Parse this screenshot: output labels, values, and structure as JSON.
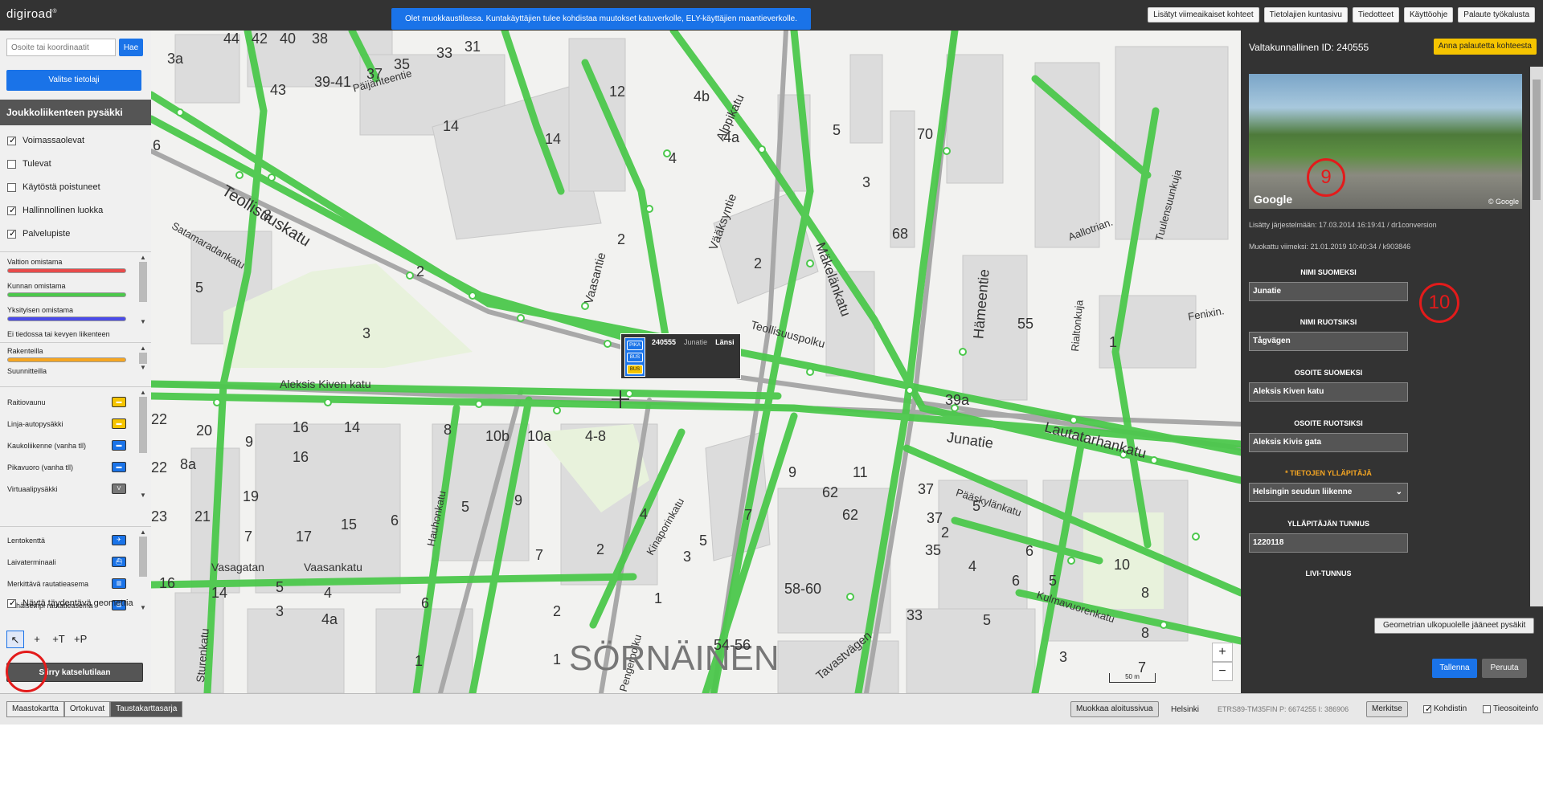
{
  "app": {
    "logo": "digiroad",
    "logo_mark": "®"
  },
  "topbar": {
    "edit_notice": "Olet muokkaustilassa. Kuntakäyttäjien tulee kohdistaa muutokset katuverkolle, ELY-käyttäjien maantieverkolle.",
    "links": [
      "Lisätyt viimeaikaiset kohteet",
      "Tietolajien kuntasivu",
      "Tiedotteet",
      "Käyttöohje",
      "Palaute työkalusta"
    ]
  },
  "left": {
    "search_placeholder": "Osoite tai koordinaatit",
    "search_button": "Hae",
    "layer_button": "Valitse tietolaji",
    "layer_title": "Joukkoliikenteen pysäkki",
    "filters": [
      {
        "label": "Voimassaolevat",
        "checked": true
      },
      {
        "label": "Tulevat",
        "checked": false
      },
      {
        "label": "Käytöstä poistuneet",
        "checked": false
      },
      {
        "label": "Hallinnollinen luokka",
        "checked": true
      },
      {
        "label": "Palvelupiste",
        "checked": true
      }
    ],
    "ownership": [
      {
        "label": "Valtion omistama",
        "color": "#e84b4b"
      },
      {
        "label": "Kunnan omistama",
        "color": "#4cc84c"
      },
      {
        "label": "Yksityisen omistama",
        "color": "#4b4be8"
      },
      {
        "label": "Ei tiedossa tai kevyen liikenteen",
        "color": ""
      }
    ],
    "construction": [
      {
        "label": "Rakenteilla",
        "color": "#f5a623"
      },
      {
        "label": "Suunnitteilla",
        "color": "#c07ad8"
      }
    ],
    "stop_types": [
      {
        "label": "Raitiovaunu",
        "icon": "tram-icon",
        "color": "#f5c400"
      },
      {
        "label": "Linja-autopysäkki",
        "icon": "bus-icon",
        "color": "#f5c400"
      },
      {
        "label": "Kaukoliikenne (vanha tll)",
        "icon": "coach-icon",
        "color": "#1a73e8"
      },
      {
        "label": "Pikavuoro (vanha tll)",
        "icon": "express-icon",
        "color": "#1a73e8"
      },
      {
        "label": "Virtuaalipysäkki",
        "icon": "virtual-icon",
        "color": "#777"
      }
    ],
    "stations": [
      {
        "label": "Lentokenttä",
        "icon": "airplane-icon"
      },
      {
        "label": "Laivaterminaali",
        "icon": "ship-icon"
      },
      {
        "label": "Merkittävä rautatieasema",
        "icon": "major-train-icon"
      },
      {
        "label": "Vähäisempi rautatieasema",
        "icon": "minor-train-icon"
      }
    ],
    "supplementary_geometry": {
      "label": "Näytä täydentävä geometria",
      "checked": true
    },
    "tools": [
      "↖",
      "+",
      "+T",
      "+P"
    ],
    "view_mode_button": "Siirry katselutilaan",
    "view_mode_prefix": "S"
  },
  "map": {
    "popup": {
      "id": "240555",
      "name": "Junatie",
      "direction": "Länsi"
    },
    "popup_icons": [
      "PIKA",
      "BUS",
      "BUS"
    ],
    "zoom_in": "+",
    "zoom_out": "−",
    "scale": "50 m",
    "district": "SÖRNÄINEN",
    "streets": [
      "Teollisuuskatu",
      "Aleksis Kiven katu",
      "Hämeentie",
      "Mäkelänkatu",
      "Lautatarhankatu",
      "Junatie",
      "Teollisuuspolku",
      "Vaasankatu",
      "Vasagatan",
      "Kinaporinkatu",
      "Hauhonkatu",
      "Sturenkatu",
      "Päijänteentie",
      "Satamaradankatu",
      "Vaasantie",
      "Tavastvägen",
      "Pääskylänkatu",
      "Kulmavuorenkatu",
      "Rialtonkuja",
      "Aallotrian.",
      "Tuulensuunkuja",
      "Fenixin.",
      "Pengerpolku",
      "Vääksyntie",
      "Alppikatu"
    ],
    "house_numbers": [
      "44",
      "42",
      "40",
      "38",
      "33",
      "31",
      "3a",
      "37",
      "35",
      "43",
      "39-41",
      "12",
      "4b",
      "4a",
      "14",
      "14",
      "4",
      "70",
      "5",
      "3",
      "68",
      "2",
      "8",
      "6",
      "2",
      "5",
      "2",
      "3",
      "55",
      "1",
      "39a",
      "22",
      "20",
      "16",
      "14",
      "8",
      "10b",
      "10a",
      "4-8",
      "9",
      "16",
      "22",
      "8a",
      "19",
      "23",
      "21",
      "7",
      "17",
      "15",
      "6",
      "5",
      "9",
      "7",
      "2",
      "4",
      "7",
      "5",
      "3",
      "1",
      "62",
      "62",
      "11",
      "9",
      "37",
      "37",
      "35",
      "5",
      "2",
      "4",
      "6",
      "6",
      "5",
      "10",
      "8",
      "8",
      "7",
      "16",
      "14",
      "5",
      "3",
      "4",
      "4a",
      "6",
      "2",
      "1",
      "1",
      "58-60",
      "54-56",
      "33",
      "5",
      "3"
    ]
  },
  "right": {
    "id_label": "Valtakunnallinen ID: 240555",
    "feedback_button": "Anna palautetta kohteesta",
    "streetview_logo": "Google",
    "streetview_copyright": "© Google",
    "added": "Lisätty järjestelmään: 17.03.2014 16:19:41 / dr1conversion",
    "modified": "Muokattu viimeksi: 21.01.2019 10:40:34 / k903846",
    "fields": [
      {
        "label": "NIMI SUOMEKSI",
        "value": "Junatie",
        "required": false
      },
      {
        "label": "NIMI RUOTSIKSI",
        "value": "Tågvägen",
        "required": false
      },
      {
        "label": "OSOITE SUOMEKSI",
        "value": "Aleksis Kiven katu",
        "required": false
      },
      {
        "label": "OSOITE RUOTSIKSI",
        "value": "Aleksis Kivis gata",
        "required": false
      },
      {
        "label": "* TIETOJEN YLLÄPITÄJÄ",
        "value": "Helsingin seudun liikenne",
        "required": true
      },
      {
        "label": "YLLÄPITÄJÄN TUNNUS",
        "value": "1220118",
        "required": false
      },
      {
        "label": "LIVI-TUNNUS",
        "value": "",
        "required": false
      }
    ],
    "annotation_9": "9",
    "annotation_10": "10",
    "geometry_button": "Geometrian ulkopuolelle jääneet pysäkit",
    "save_button": "Tallenna",
    "cancel_button": "Peruuta"
  },
  "bottom": {
    "base_tabs": [
      {
        "label": "Maastokartta",
        "active": false
      },
      {
        "label": "Ortokuvat",
        "active": false
      },
      {
        "label": "Taustakarttasarja",
        "active": true
      }
    ],
    "edit_home_button": "Muokkaa aloitussivua",
    "municipality": "Helsinki",
    "coords": "ETRS89-TM35FIN  P: 6674255  I: 386906",
    "mark_button": "Merkitse",
    "center_checkbox": "Kohdistin",
    "road_address_checkbox": "Tieosoiteinfo"
  }
}
